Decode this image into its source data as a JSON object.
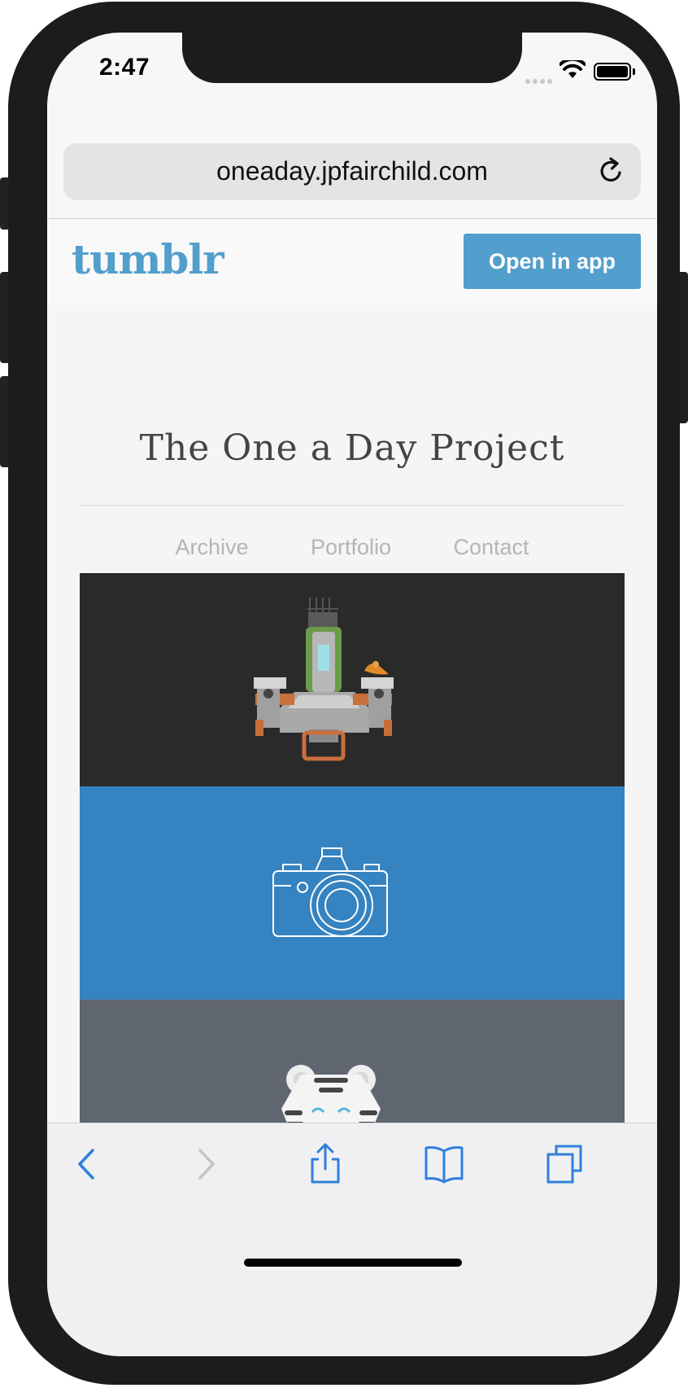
{
  "status": {
    "time": "2:47"
  },
  "browser": {
    "url": "oneaday.jpfairchild.com"
  },
  "tumblr": {
    "logo": "tumblr",
    "open_app": "Open in app"
  },
  "site": {
    "title": "The One a Day Project",
    "nav": [
      "Archive",
      "Portfolio",
      "Contact"
    ]
  },
  "posts": [
    {
      "illustration": "robot-with-bird",
      "background": "#2a2a2a"
    },
    {
      "illustration": "camera-outline",
      "background": "#3583c0"
    },
    {
      "illustration": "white-tiger-face",
      "background": "#5f6670"
    }
  ],
  "toolbar": {
    "icons": [
      "back-icon",
      "forward-icon",
      "share-icon",
      "bookmarks-icon",
      "tabs-icon"
    ],
    "accent": "#2f7fdc"
  },
  "colors": {
    "tumblr_blue": "#529ecc"
  }
}
